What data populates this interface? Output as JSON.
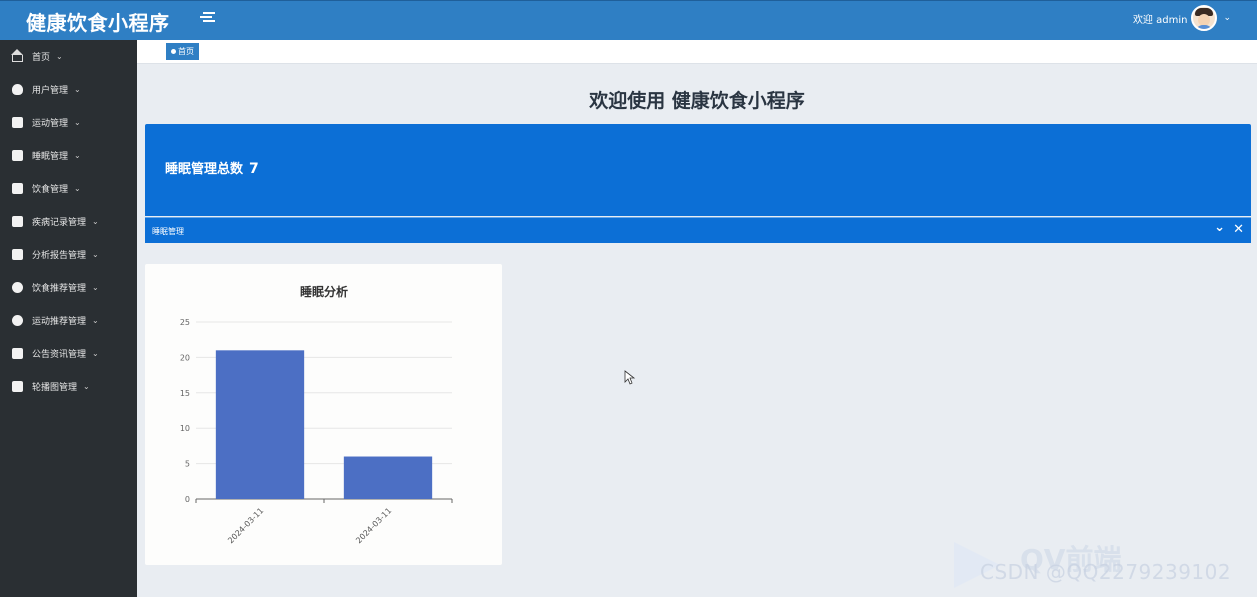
{
  "app": {
    "title": "健康饮食小程序"
  },
  "header": {
    "welcome": "欢迎 admin",
    "menu_toggle_icon": "menu-fold-icon"
  },
  "sidebar": {
    "items": [
      {
        "label": "首页",
        "icon": "home-icon"
      },
      {
        "label": "用户管理",
        "icon": "user-icon"
      },
      {
        "label": "运动管理",
        "icon": "activity-icon"
      },
      {
        "label": "睡眠管理",
        "icon": "bed-icon"
      },
      {
        "label": "饮食管理",
        "icon": "book-icon"
      },
      {
        "label": "疾病记录管理",
        "icon": "book-icon"
      },
      {
        "label": "分析报告管理",
        "icon": "briefcase-icon"
      },
      {
        "label": "饮食推荐管理",
        "icon": "info-icon"
      },
      {
        "label": "运动推荐管理",
        "icon": "chat-icon"
      },
      {
        "label": "公告资讯管理",
        "icon": "layout-icon"
      },
      {
        "label": "轮播图管理",
        "icon": "briefcase-icon"
      }
    ]
  },
  "breadcrumb": {
    "home": "首页"
  },
  "main": {
    "title": "欢迎使用 健康饮食小程序",
    "stat": {
      "label": "睡眠管理总数",
      "count": "7",
      "footer": "睡眠管理"
    }
  },
  "colors": {
    "primary": "#2f7fc4",
    "card_blue": "#0c6fd6",
    "bar": "#4c6fc4",
    "sidebar": "#2a2f33"
  },
  "chart_data": {
    "type": "bar",
    "title": "睡眠分析",
    "categories": [
      "2024-03-11",
      "2024-03-11"
    ],
    "values": [
      21,
      6
    ],
    "ylim": [
      0,
      25
    ],
    "yticks": [
      0,
      5,
      10,
      15,
      20,
      25
    ],
    "xlabel": "",
    "ylabel": "",
    "grid": true
  },
  "watermark": {
    "text": "CSDN @QQ2279239102",
    "brand": "QV前端"
  }
}
